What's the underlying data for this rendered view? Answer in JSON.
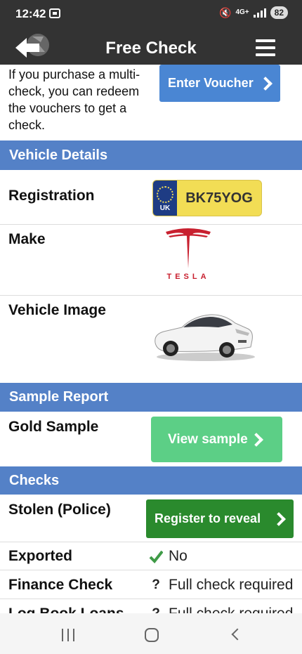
{
  "status_bar": {
    "time": "12:42",
    "network": "4G+",
    "battery": "82"
  },
  "header": {
    "title": "Free Check",
    "back_icon": "back-arrow-icon",
    "menu_icon": "hamburger-menu-icon"
  },
  "voucher": {
    "text": "If you purchase a multi-check, you can redeem the vouchers to get a check.",
    "button_label": "Enter Voucher"
  },
  "vehicle_details": {
    "heading": "Vehicle Details",
    "registration_label": "Registration",
    "plate_country": "UK",
    "registration": "BK75YOG",
    "make_label": "Make",
    "make_logo_text": "TESLA",
    "image_label": "Vehicle Image"
  },
  "sample_report": {
    "heading": "Sample Report",
    "gold_sample_label": "Gold Sample",
    "view_sample_button": "View sample"
  },
  "checks": {
    "heading": "Checks",
    "stolen_label": "Stolen (Police)",
    "stolen_button": "Register to reveal",
    "items": [
      {
        "label": "Exported",
        "value": "No",
        "icon": "check-icon"
      },
      {
        "label": "Finance Check",
        "value": "Full check required",
        "icon": "question-icon"
      },
      {
        "label": "Log Book Loans",
        "value": "Full check required",
        "icon": "question-icon"
      }
    ]
  },
  "colors": {
    "header_bg": "#333333",
    "section_bg": "#5481c7",
    "voucher_button": "#4a86d3",
    "sample_button": "#5ccf86",
    "reveal_button": "#2a8a2d",
    "plate_yellow": "#f2dd55",
    "tesla_red": "#c8202f"
  }
}
